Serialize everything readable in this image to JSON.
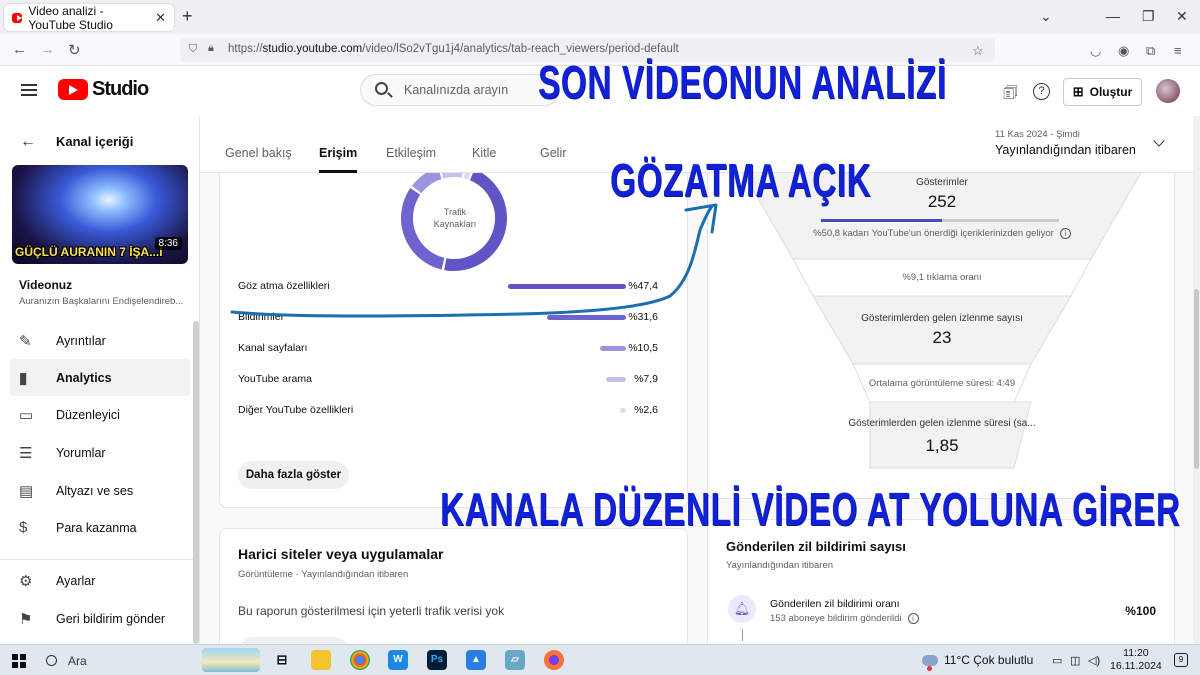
{
  "browser": {
    "tab_title": "Video analizi - YouTube Studio",
    "url_prefix": "https://",
    "url_domain": "studio.youtube.com",
    "url_path": "/video/lSo2vTgu1j4/analytics/tab-reach_viewers/period-default",
    "close_glyph": "✕",
    "new_tab_glyph": "+"
  },
  "header": {
    "logo_text": "Studio",
    "search_placeholder": "Kanalınızda arayın",
    "create_label": "Oluştur"
  },
  "sidebar": {
    "back_title": "Kanal içeriği",
    "thumbnail_title": "GÜÇLÜ AURANIN 7 İŞA...İ",
    "thumbnail_duration": "8:36",
    "video_label": "Videonuz",
    "video_subtitle": "Auranızın Başkalarını Endişelendireb...",
    "items": [
      {
        "label": "Ayrıntılar",
        "icon": "pencil-icon"
      },
      {
        "label": "Analytics",
        "icon": "analytics-icon"
      },
      {
        "label": "Düzenleyici",
        "icon": "editor-icon"
      },
      {
        "label": "Yorumlar",
        "icon": "comments-icon"
      },
      {
        "label": "Altyazı ve ses",
        "icon": "subtitles-icon"
      },
      {
        "label": "Para kazanma",
        "icon": "dollar-icon"
      }
    ],
    "bottom_items": [
      {
        "label": "Ayarlar",
        "icon": "gear-icon"
      },
      {
        "label": "Geri bildirim gönder",
        "icon": "feedback-icon"
      }
    ]
  },
  "tabs": [
    "Genel bakış",
    "Erişim",
    "Etkileşim",
    "Kitle",
    "Gelir"
  ],
  "active_tab": "Erişim",
  "date_range": {
    "line1": "11 Kas 2024 - Şimdi",
    "line2": "Yayınlandığından itibaren"
  },
  "traffic_sources": {
    "donut_label": "Trafik Kaynakları",
    "rows": [
      {
        "name": "Göz atma özellikleri",
        "pct": "%47,4",
        "value": 47.4
      },
      {
        "name": "Bildirimler",
        "pct": "%31,6",
        "value": 31.6
      },
      {
        "name": "Kanal sayfaları",
        "pct": "%10,5",
        "value": 10.5
      },
      {
        "name": "YouTube arama",
        "pct": "%7,9",
        "value": 7.9
      },
      {
        "name": "Diğer YouTube özellikleri",
        "pct": "%2,6",
        "value": 2.6
      }
    ],
    "more_button": "Daha fazla göster"
  },
  "external": {
    "title": "Harici siteler veya uygulamalar",
    "subtitle": "Görüntüleme · Yayınlandığından itibaren",
    "message": "Bu raporun gösterilmesi için yeterli trafik verisi yok"
  },
  "funnel": {
    "impressions_label": "Gösterimler",
    "impressions_value": "252",
    "impressions_share": 0.508,
    "impressions_note": "%50,8 kadarı YouTube'un önerdiği içeriklerinizden geliyor",
    "ctr": "%9,1 tıklama oranı",
    "views_label": "Gösterimlerden gelen izlenme sayısı",
    "views_value": "23",
    "avg_duration": "Ortalama görüntüleme süresi: 4:49",
    "watch_label": "Gösterimlerden gelen izlenme süresi (sa...",
    "watch_value": "1,85"
  },
  "bell": {
    "title": "Gönderilen zil bildirimi sayısı",
    "subtitle": "Yayınlandığından itibaren",
    "rate_label": "Gönderilen zil bildirimi oranı",
    "rate_sub": "153 aboneye bildirim gönderildi",
    "rate_value": "%100"
  },
  "overlays": {
    "top": "SON VİDEONUN ANALİZİ",
    "middle": "GÖZATMA AÇIK",
    "bottom": "KANALA DÜZENLİ VİDEO AT YOLUNA GİRER"
  },
  "taskbar": {
    "search": "Ara",
    "weather": "11°C  Çok bulutlu",
    "time": "11:20",
    "date": "16.11.2024",
    "notif_count": "9"
  },
  "colors": {
    "accent": "#5f55c7",
    "overlay": "#1021d8",
    "annotation": "#1b6fae"
  }
}
